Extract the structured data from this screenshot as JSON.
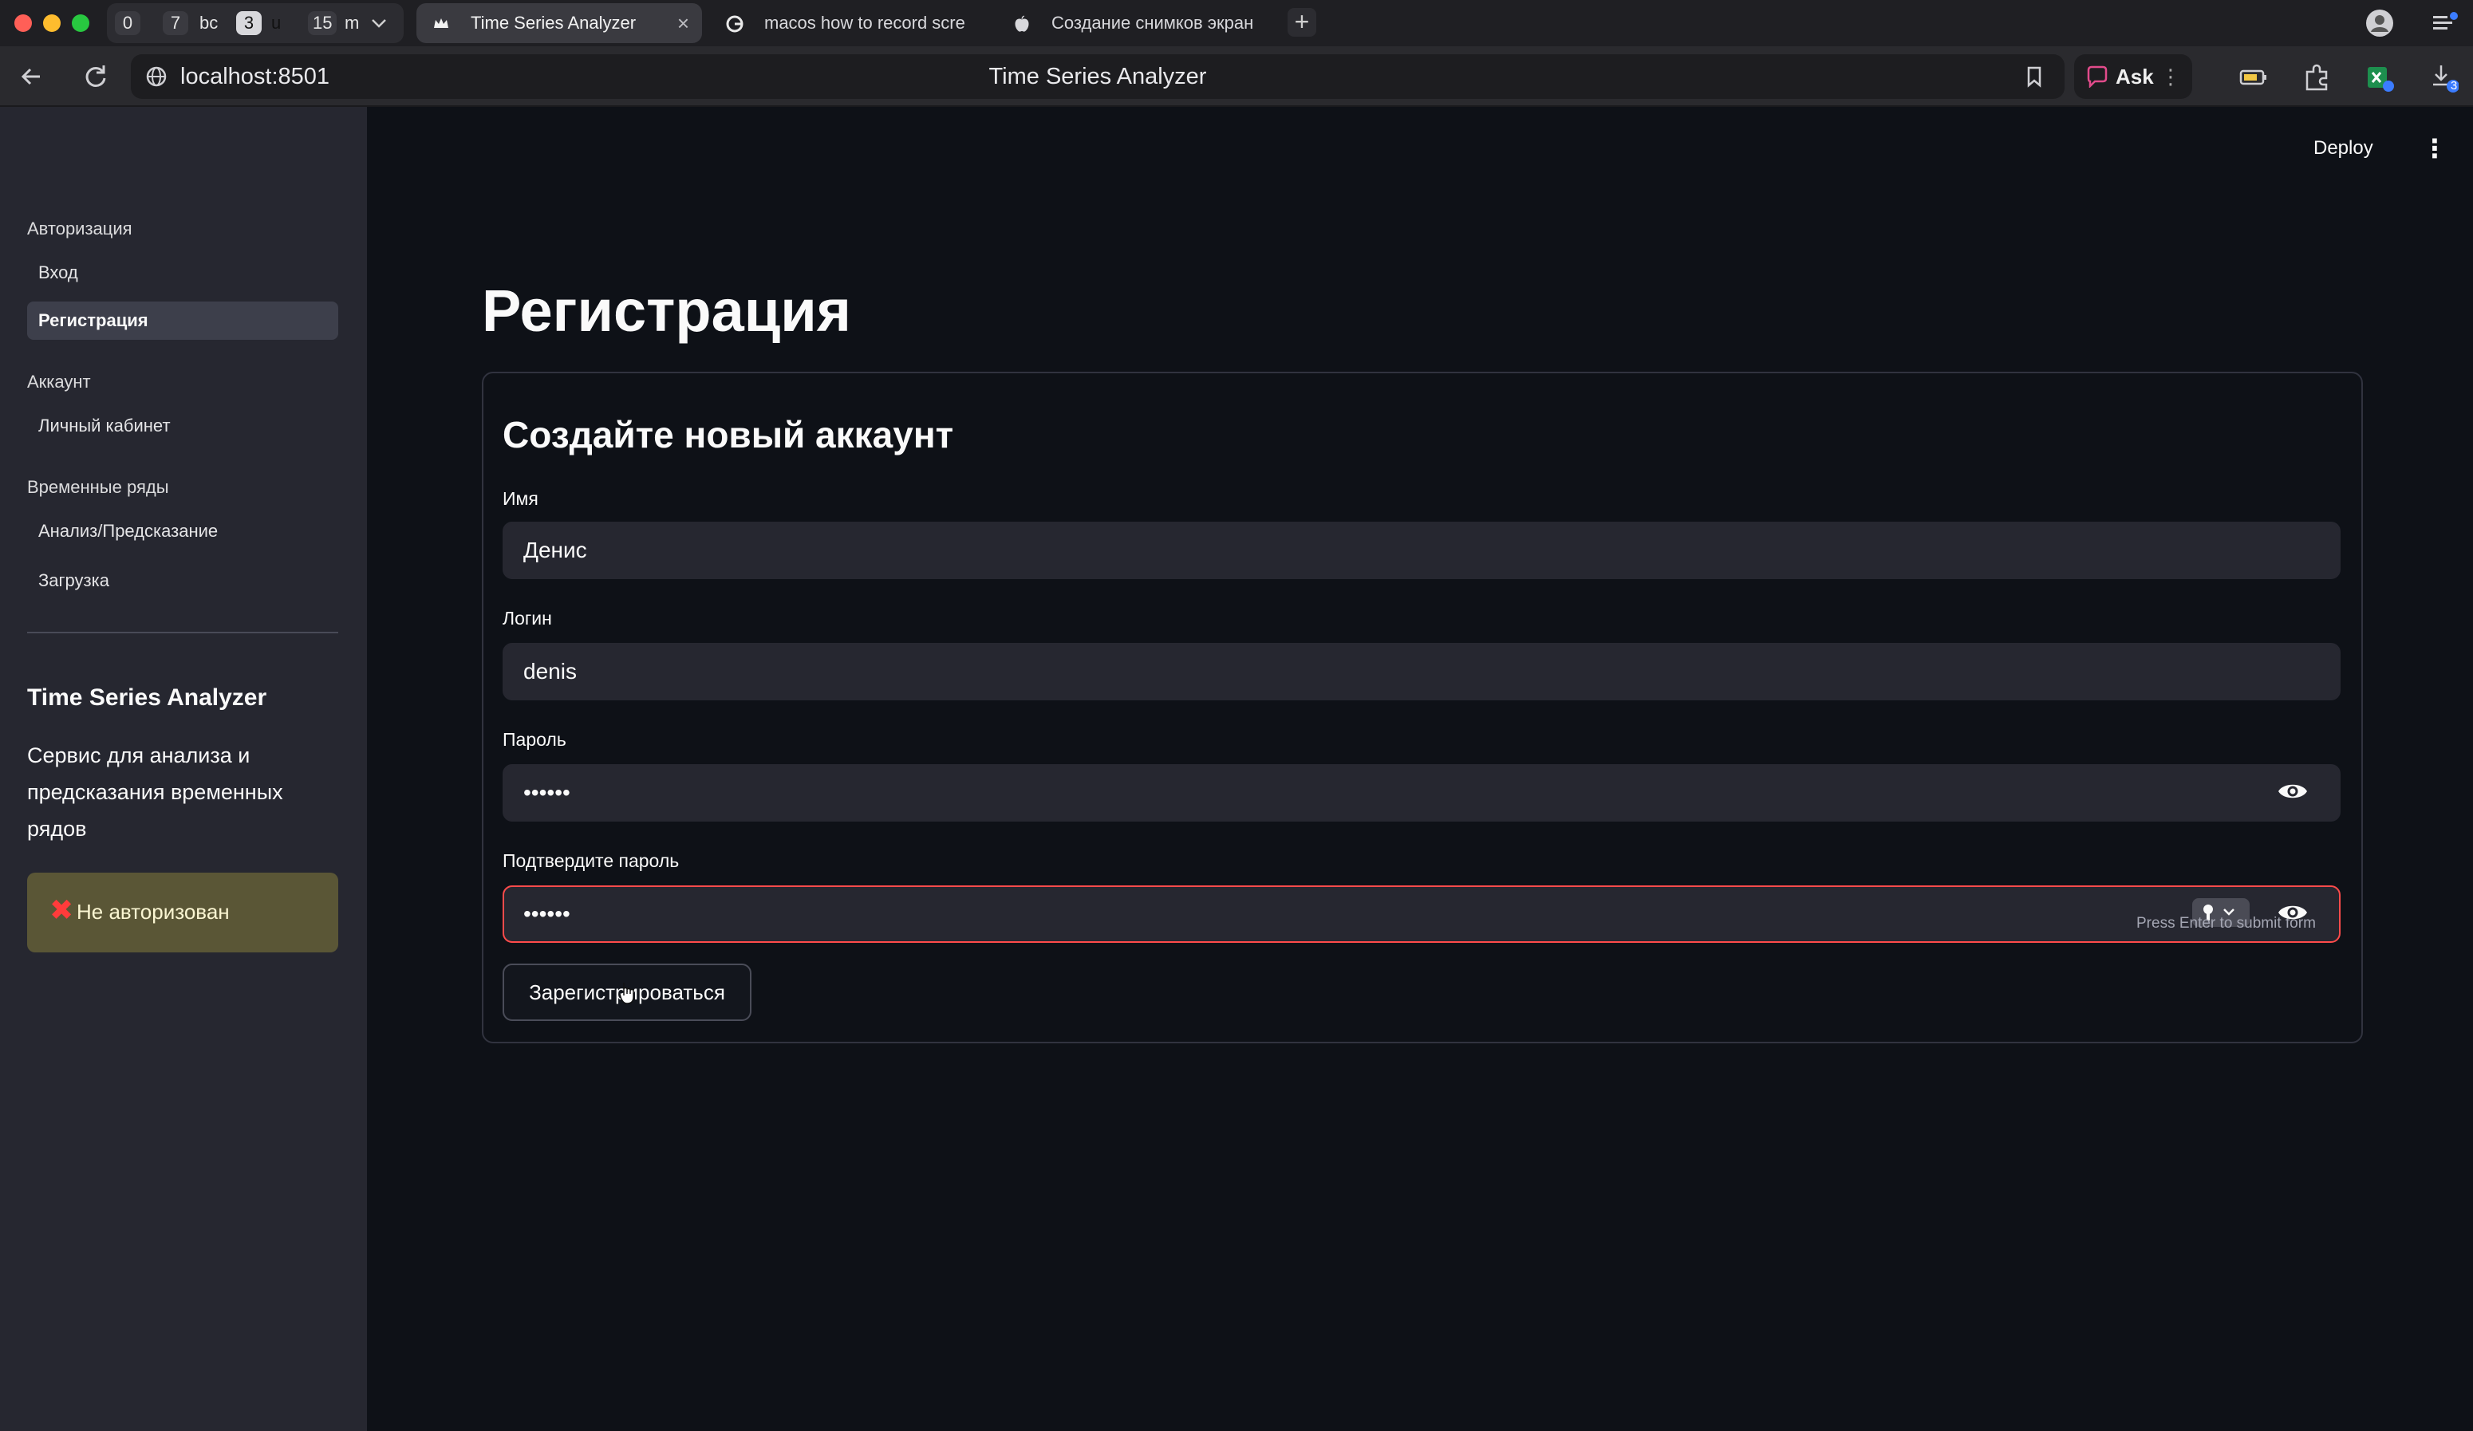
{
  "browser": {
    "tab_groups": [
      {
        "count": "0",
        "label": ""
      },
      {
        "count": "7",
        "label": "bc"
      },
      {
        "count": "3",
        "label": "u"
      },
      {
        "count": "15",
        "label": "m"
      }
    ],
    "tabs": [
      {
        "label": "Time Series Analyzer",
        "active": true
      },
      {
        "label": "macos how to record scre",
        "active": false
      },
      {
        "label": "Создание снимков экран",
        "active": false
      }
    ],
    "close_glyph": "×",
    "new_tab_glyph": "+",
    "url": "localhost:8501",
    "page_title": "Time Series Analyzer",
    "ask_label": "Ask",
    "ask_menu_glyph": "⋮",
    "extension_badge": "3",
    "colors": {
      "close": "#ff5f57",
      "minimize": "#febc2e",
      "zoom": "#28c840"
    }
  },
  "sidebar": {
    "sections": [
      {
        "title": "Авторизация",
        "items": [
          {
            "label": "Вход",
            "active": false
          },
          {
            "label": "Регистрация",
            "active": true
          }
        ]
      },
      {
        "title": "Аккаунт",
        "items": [
          {
            "label": "Личный кабинет",
            "active": false
          }
        ]
      },
      {
        "title": "Временные ряды",
        "items": [
          {
            "label": "Анализ/Предсказание",
            "active": false
          },
          {
            "label": "Загрузка",
            "active": false
          }
        ]
      }
    ],
    "app_title": "Time Series Analyzer",
    "app_description": "Сервис для анализа и предсказания временных рядов",
    "status": {
      "icon": "cross-mark-icon",
      "glyph": "✖",
      "label": "Не авторизован",
      "color": "#ff3b3b"
    }
  },
  "header": {
    "deploy_label": "Deploy",
    "menu_glyph": "⋮"
  },
  "main": {
    "title": "Регистрация",
    "form": {
      "heading": "Создайте новый аккаунт",
      "fields": [
        {
          "label": "Имя",
          "value": "Денис"
        },
        {
          "label": "Логин",
          "value": "denis"
        },
        {
          "label": "Пароль",
          "value": "••••••"
        },
        {
          "label": "Подтвердите пароль",
          "value": "••••••"
        }
      ],
      "hint": "Press Enter to submit form",
      "submit_label": "Зарегистрироваться",
      "error_color": "#ff4b4b"
    }
  }
}
